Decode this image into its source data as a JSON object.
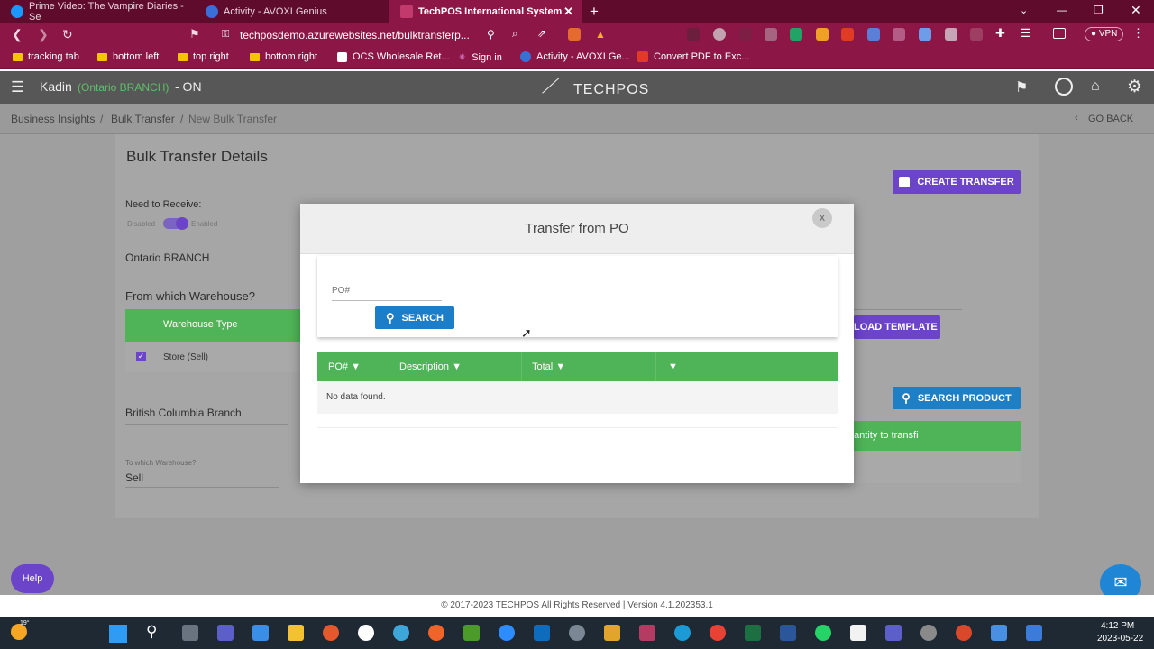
{
  "browser": {
    "tabs": [
      {
        "label": "Prime Video: The Vampire Diaries - Se",
        "active": false
      },
      {
        "label": "Activity - AVOXI Genius",
        "active": false
      },
      {
        "label": "TechPOS International System",
        "active": true
      }
    ],
    "new_tab": "+",
    "url": "techposdemo.azurewebsites.net/bulktransferp...",
    "bookmarks": [
      "tracking tab",
      "bottom left",
      "top right",
      "bottom right",
      "OCS Wholesale Ret...",
      "Sign in",
      "Activity - AVOXI Ge...",
      "Convert PDF to Exc..."
    ],
    "vpn": "VPN"
  },
  "app": {
    "user": "Kadin",
    "branch": "(Ontario BRANCH)",
    "status": "- ON",
    "logo": "TECHPOS",
    "breadcrumbs": [
      "Business Insights",
      "Bulk Transfer",
      "New Bulk Transfer"
    ],
    "go_back": "GO BACK"
  },
  "page": {
    "title": "Bulk Transfer Details",
    "need_to_receive": "Need to Receive:",
    "toggle_off": "Disabled",
    "toggle_on": "Enabled",
    "from_branch": "Ontario BRANCH",
    "from_question": "From which Warehouse?",
    "warehouse_type_header": "Warehouse Type",
    "warehouse_option": "Store (Sell)",
    "to_branch": "British Columbia Branch",
    "to_question": "To which Warehouse?",
    "to_value": "Sell",
    "create_transfer": "CREATE TRANSFER",
    "upload_template": "LOAD TEMPLATE",
    "search_product": "SEARCH PRODUCT",
    "qty_header": "antity to transfi"
  },
  "modal": {
    "title": "Transfer from PO",
    "close": "x",
    "po_placeholder": "PO#",
    "search_button": "SEARCH",
    "columns": [
      "PO#",
      "Description",
      "Total",
      ""
    ],
    "empty": "No data found."
  },
  "footer": "© 2017-2023 TECHPOS All Rights Reserved | Version 4.1.202353.1",
  "help": "Help",
  "taskbar": {
    "time": "4:12 PM",
    "date": "2023-05-22",
    "temp": "19°"
  },
  "colors": {
    "tabbar": "#5e0b2c",
    "chrome": "#8c1746",
    "green": "#4fb458",
    "purple": "#6c44c9",
    "blue": "#1f7fc4"
  }
}
